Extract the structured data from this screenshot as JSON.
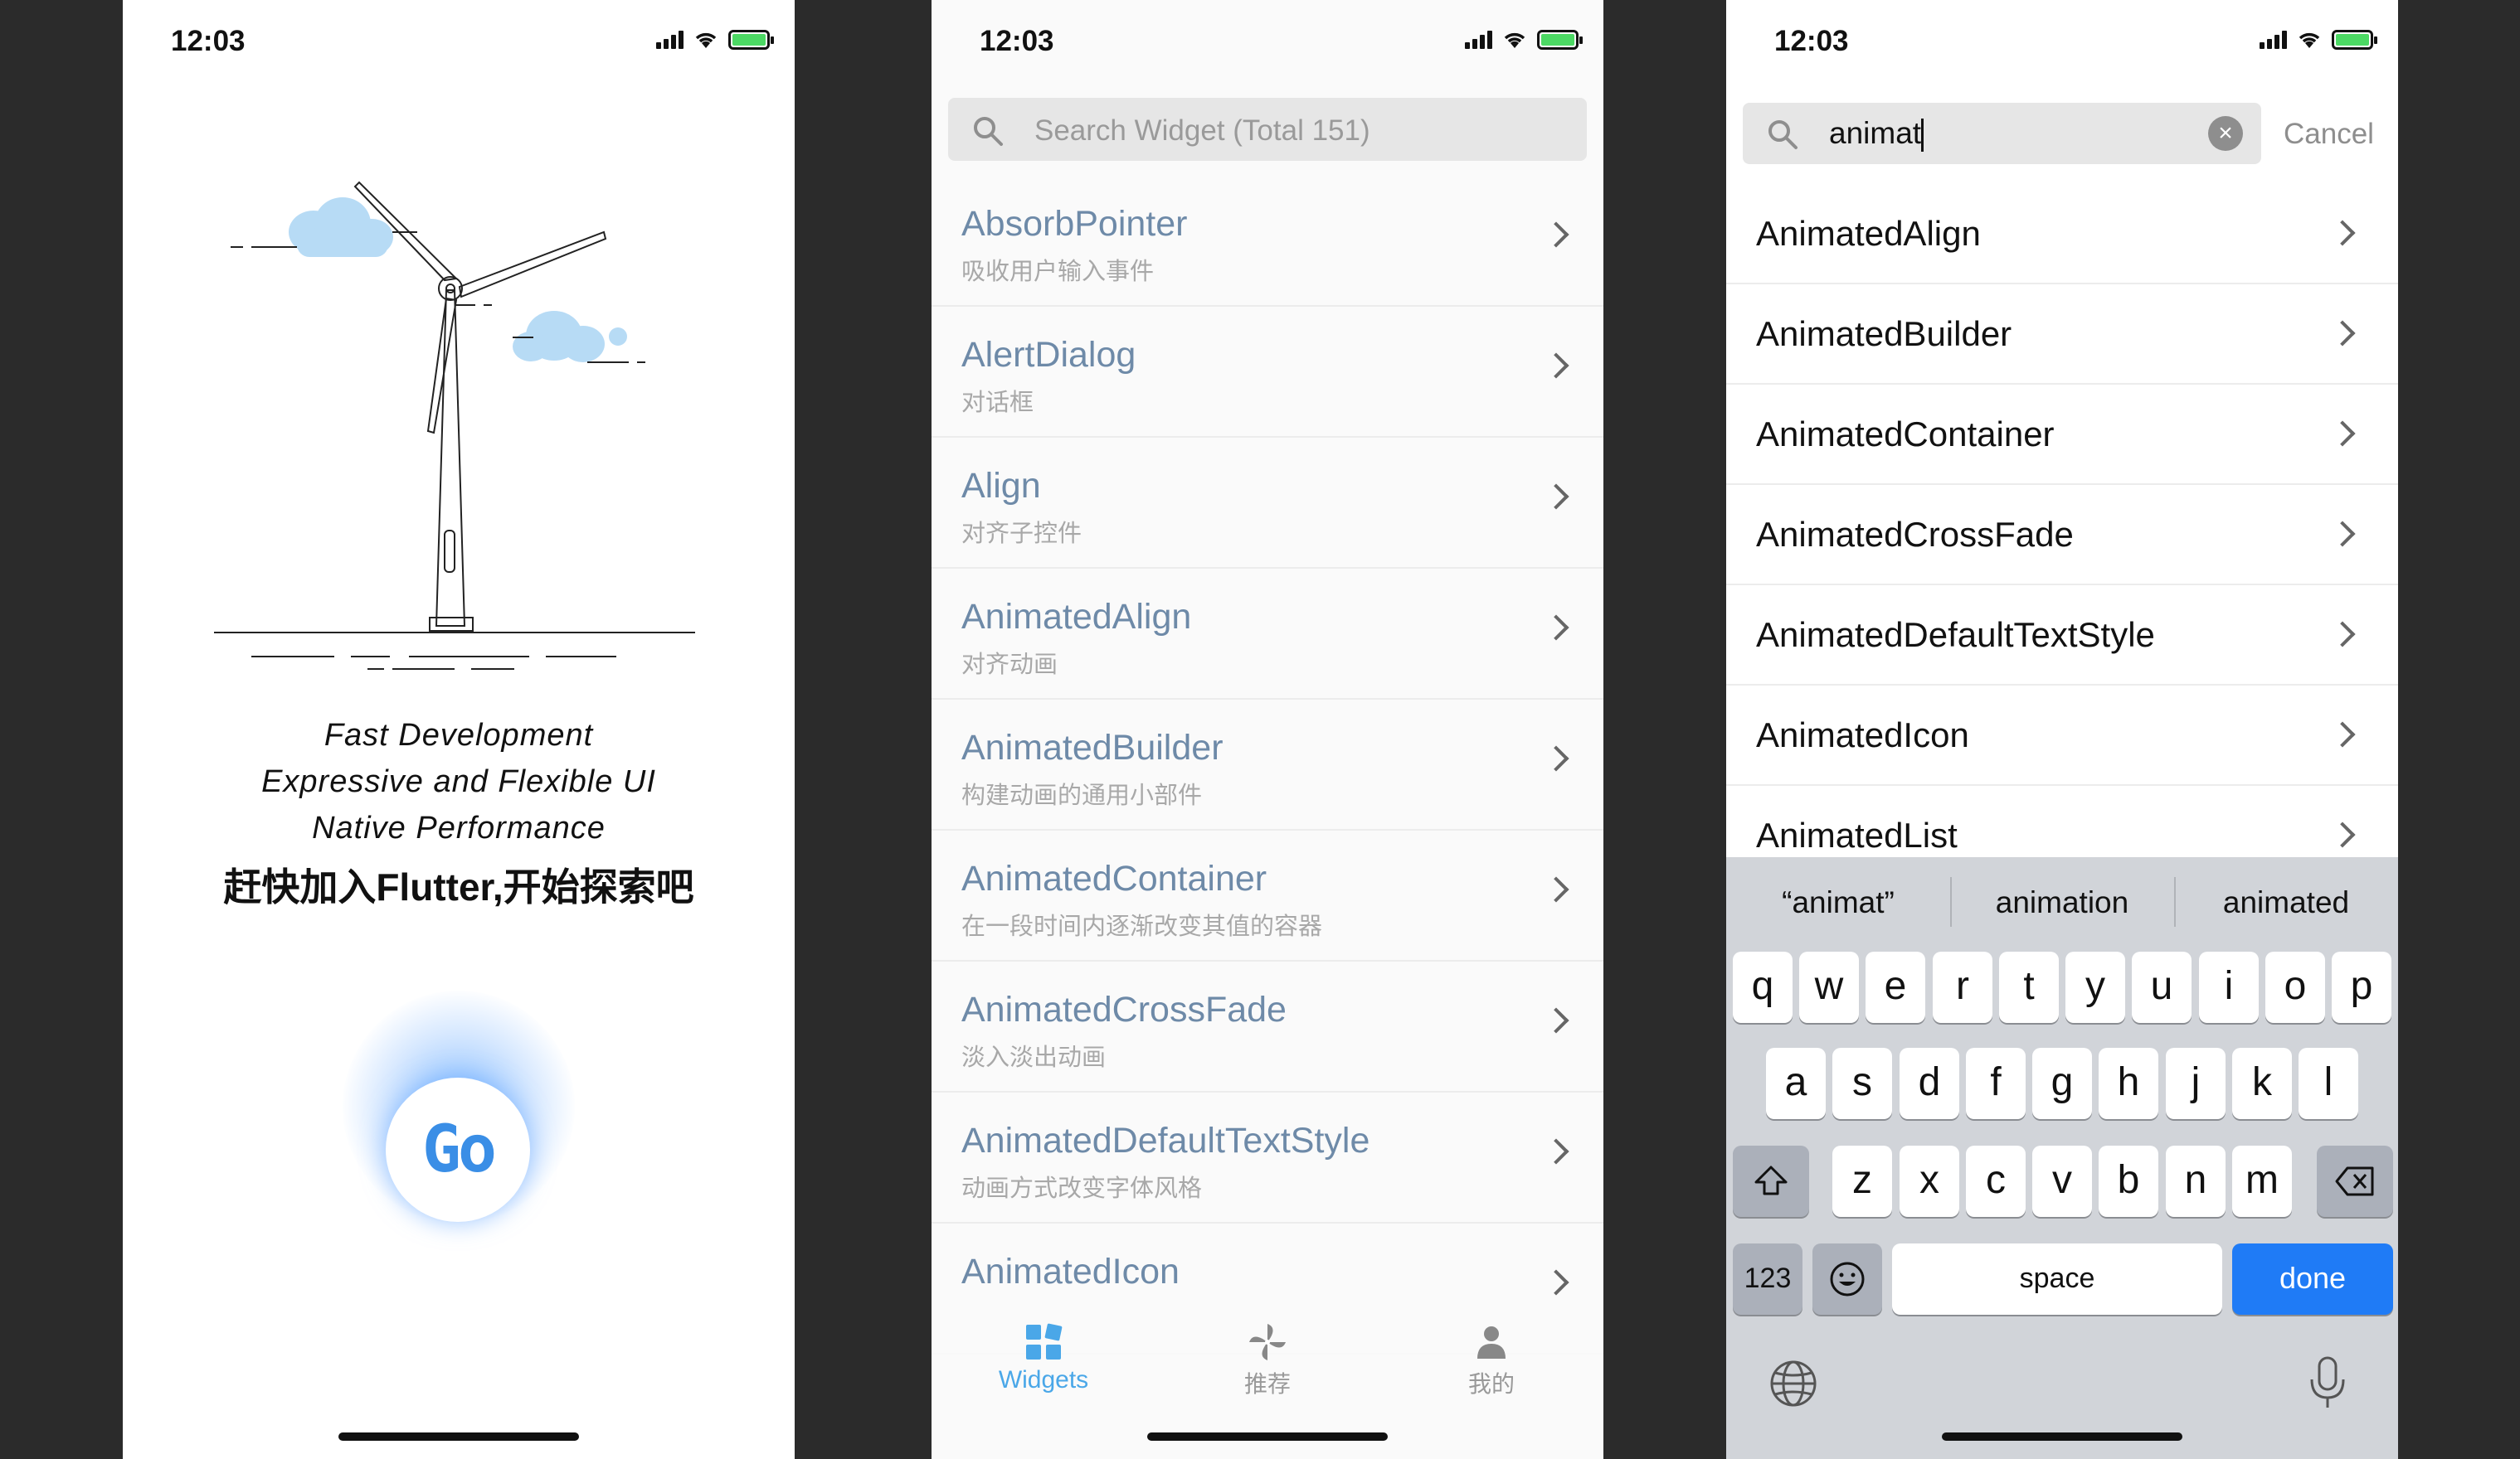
{
  "status": {
    "time": "12:03"
  },
  "splash": {
    "line1": "Fast Development",
    "line2": "Expressive and Flexible UI",
    "line3": "Native Performance",
    "line4": "赶快加入Flutter,开始探索吧",
    "go_label": "Go"
  },
  "widgets_page": {
    "search_placeholder": "Search Widget (Total 151)",
    "items": [
      {
        "title": "AbsorbPointer",
        "subtitle": "吸收用户输入事件"
      },
      {
        "title": "AlertDialog",
        "subtitle": "对话框"
      },
      {
        "title": "Align",
        "subtitle": "对齐子控件"
      },
      {
        "title": "AnimatedAlign",
        "subtitle": "对齐动画"
      },
      {
        "title": "AnimatedBuilder",
        "subtitle": "构建动画的通用小部件"
      },
      {
        "title": "AnimatedContainer",
        "subtitle": "在一段时间内逐渐改变其值的容器"
      },
      {
        "title": "AnimatedCrossFade",
        "subtitle": "淡入淡出动画"
      },
      {
        "title": "AnimatedDefaultTextStyle",
        "subtitle": "动画方式改变字体风格"
      },
      {
        "title": "AnimatedIcon",
        "subtitle": ""
      }
    ],
    "tabs": [
      {
        "label": "Widgets",
        "icon": "widgets-grid-icon",
        "active": true
      },
      {
        "label": "推荐",
        "icon": "pinwheel-icon",
        "active": false
      },
      {
        "label": "我的",
        "icon": "person-icon",
        "active": false
      }
    ],
    "accent": "#4aa7e8"
  },
  "search_page": {
    "query": "animat",
    "cancel_label": "Cancel",
    "results": [
      "AnimatedAlign",
      "AnimatedBuilder",
      "AnimatedContainer",
      "AnimatedCrossFade",
      "AnimatedDefaultTextStyle",
      "AnimatedIcon",
      "AnimatedList"
    ],
    "keyboard": {
      "suggestions": [
        "“animat”",
        "animation",
        "animated"
      ],
      "row1": [
        "q",
        "w",
        "e",
        "r",
        "t",
        "y",
        "u",
        "i",
        "o",
        "p"
      ],
      "row2": [
        "a",
        "s",
        "d",
        "f",
        "g",
        "h",
        "j",
        "k",
        "l"
      ],
      "row3": [
        "z",
        "x",
        "c",
        "v",
        "b",
        "n",
        "m"
      ],
      "numbers_key": "123",
      "space_key": "space",
      "done_key": "done",
      "done_color": "#1f7bf6"
    }
  }
}
